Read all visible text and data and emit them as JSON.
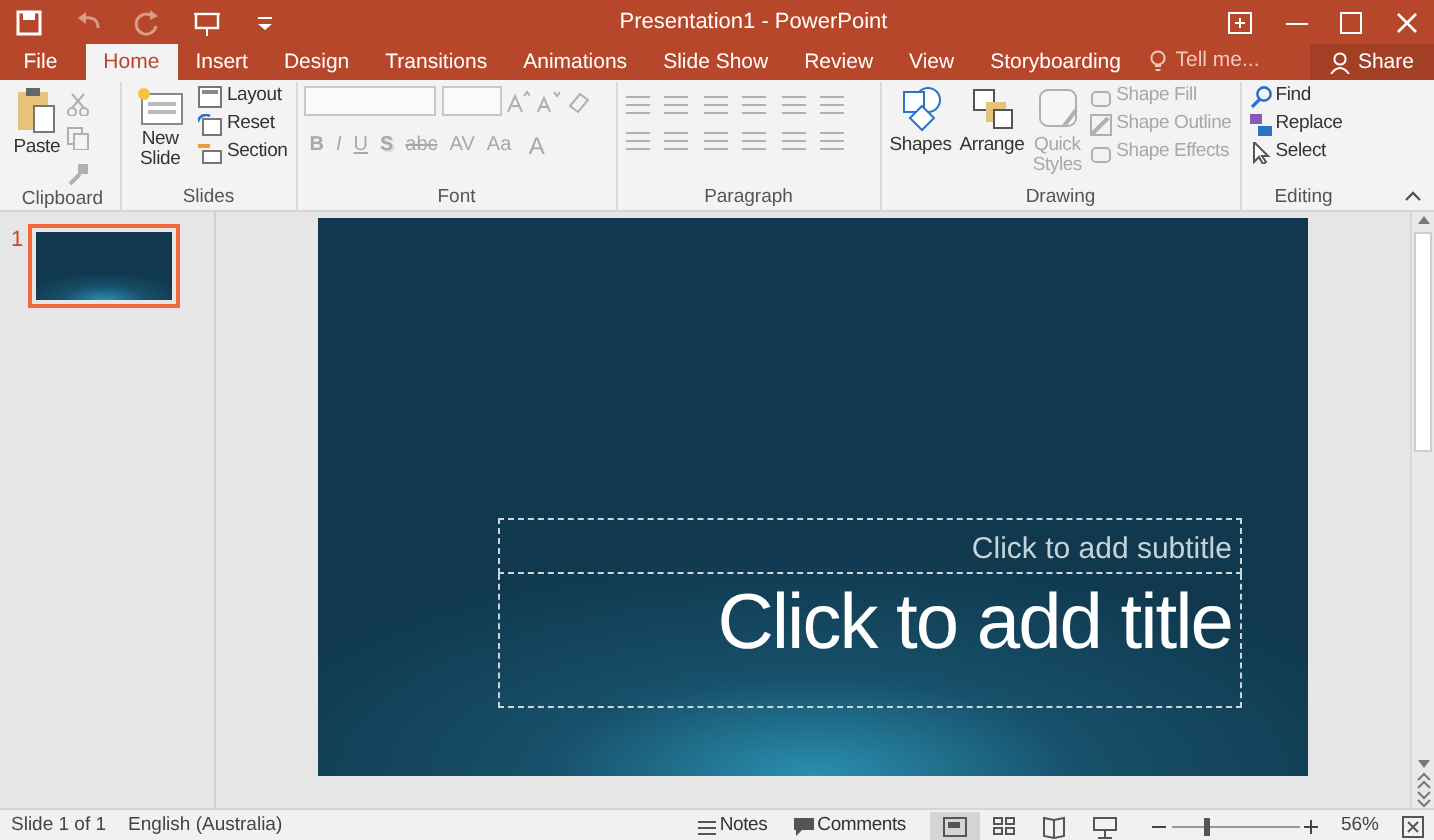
{
  "quick_access": [
    {
      "kind": "save",
      "disabled": false
    },
    {
      "kind": "undo",
      "disabled": true
    },
    {
      "kind": "redo",
      "disabled": true
    },
    {
      "kind": "present",
      "disabled": false
    },
    {
      "kind": "customize",
      "disabled": false
    }
  ],
  "window": {
    "title": "Presentation1 - PowerPoint"
  },
  "tabs": [
    {
      "label": "File",
      "selected": false
    },
    {
      "label": "Home",
      "selected": true
    },
    {
      "label": "Insert",
      "selected": false
    },
    {
      "label": "Design",
      "selected": false
    },
    {
      "label": "Transitions",
      "selected": false
    },
    {
      "label": "Animations",
      "selected": false
    },
    {
      "label": "Slide Show",
      "selected": false
    },
    {
      "label": "Review",
      "selected": false
    },
    {
      "label": "View",
      "selected": false
    },
    {
      "label": "Storyboarding",
      "selected": false
    }
  ],
  "tell_me": {
    "placeholder": "Tell me..."
  },
  "share": "Share",
  "ribbon": {
    "clipboard": {
      "label": "Clipboard",
      "paste": "Paste",
      "small": [
        {
          "kind": "cut",
          "disabled": true
        },
        {
          "kind": "copy",
          "disabled": true
        },
        {
          "kind": "painter",
          "disabled": true
        }
      ]
    },
    "slides": {
      "label": "Slides",
      "new_slide": "New Slide",
      "buttons": [
        {
          "kind": "layout",
          "label": "Layout"
        },
        {
          "kind": "reset",
          "label": "Reset"
        },
        {
          "kind": "section",
          "label": "Section"
        }
      ]
    },
    "font": {
      "label": "Font",
      "disabled": true,
      "buttons": [
        {
          "kind": "bold",
          "label": "B"
        },
        {
          "kind": "italic",
          "label": "I"
        },
        {
          "kind": "underline",
          "label": "U"
        },
        {
          "kind": "shadow",
          "label": "S"
        },
        {
          "kind": "strike",
          "label": "abc"
        },
        {
          "kind": "spacing",
          "label": "AV"
        },
        {
          "kind": "case",
          "label": "Aa"
        }
      ],
      "color_button": "A"
    },
    "paragraph": {
      "label": "Paragraph"
    },
    "drawing": {
      "label": "Drawing",
      "large": [
        {
          "kind": "shapes",
          "label": "Shapes",
          "disabled": false
        },
        {
          "kind": "arrange",
          "label": "Arrange",
          "disabled": false
        },
        {
          "kind": "styles",
          "label": "Quick Styles",
          "disabled": true
        }
      ],
      "small": [
        {
          "kind": "fill",
          "label": "Shape Fill",
          "disabled": true
        },
        {
          "kind": "outline",
          "label": "Shape Outline",
          "disabled": true
        },
        {
          "kind": "effects",
          "label": "Shape Effects",
          "disabled": true
        }
      ]
    },
    "editing": {
      "label": "Editing",
      "items": [
        {
          "kind": "find",
          "label": "Find"
        },
        {
          "kind": "replace",
          "label": "Replace"
        },
        {
          "kind": "select",
          "label": "Select"
        }
      ]
    }
  },
  "slides_panel": [
    {
      "number": "1",
      "selected": true
    }
  ],
  "slide": {
    "subtitle_placeholder": "Click to add subtitle",
    "title_placeholder": "Click to add title"
  },
  "status_bar": {
    "slide": "Slide 1 of 1",
    "language": "English (Australia)",
    "notes": "Notes",
    "comments": "Comments",
    "views": [
      {
        "kind": "normal",
        "selected": true
      },
      {
        "kind": "sorter",
        "selected": false
      },
      {
        "kind": "reading",
        "selected": false
      },
      {
        "kind": "slideshow",
        "selected": false
      }
    ],
    "zoom": {
      "level": 0.27,
      "reading": "56%"
    }
  }
}
